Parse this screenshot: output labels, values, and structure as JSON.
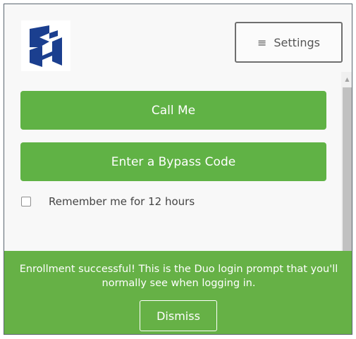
{
  "header": {
    "logo_icon": "institution-logo-icon",
    "settings_label": "Settings",
    "settings_icon": "hamburger-menu-icon"
  },
  "actions": {
    "call_label": "Call Me",
    "bypass_label": "Enter a Bypass Code"
  },
  "remember": {
    "label": "Remember me for 12 hours",
    "checked": false
  },
  "banner": {
    "message": "Enrollment successful! This is the Duo login prompt that you'll normally see when logging in.",
    "dismiss_label": "Dismiss"
  },
  "colors": {
    "accent_green": "#60b245",
    "banner_green": "#66b146",
    "logo_blue": "#1b3f8f"
  }
}
